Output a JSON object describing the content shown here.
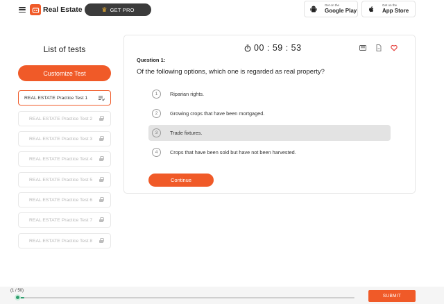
{
  "header": {
    "brand": "Real Estate",
    "get_pro": "GET PRO",
    "google_play": {
      "small": "Get on the",
      "big": "Google Play"
    },
    "app_store": {
      "small": "Get on the",
      "big": "App Store"
    }
  },
  "sidebar": {
    "title": "List of tests",
    "customize_label": "Customize Test",
    "tests": [
      {
        "label": "REAL ESTATE Practice Test 1",
        "active": true
      },
      {
        "label": "REAL ESTATE Practice Test 2",
        "locked": true
      },
      {
        "label": "REAL ESTATE Practice Test 3",
        "locked": true
      },
      {
        "label": "REAL ESTATE Practice Test 4",
        "locked": true
      },
      {
        "label": "REAL ESTATE Practice Test 5",
        "locked": true
      },
      {
        "label": "REAL ESTATE Practice Test 6",
        "locked": true
      },
      {
        "label": "REAL ESTATE Practice Test 7",
        "locked": true
      },
      {
        "label": "REAL ESTATE Practice Test 8",
        "locked": true
      }
    ]
  },
  "question": {
    "timer": "00 : 59 : 53",
    "label": "Question 1:",
    "text": "Of the following options, which one is regarded as real property?",
    "options": [
      {
        "num": "1",
        "text": "Riparian rights."
      },
      {
        "num": "2",
        "text": "Growing crops that have been mortgaged."
      },
      {
        "num": "3",
        "text": "Trade fixtures.",
        "selected": true
      },
      {
        "num": "4",
        "text": "Crops that have been sold but have not been harvested."
      }
    ],
    "continue_label": "Continue"
  },
  "footer": {
    "progress_label": "(1 / 50)",
    "progress_fraction": 0.02,
    "submit_label": "SUBMIT"
  },
  "colors": {
    "accent": "#f05a28",
    "progress": "#2f9e6e",
    "heart": "#e53935"
  }
}
